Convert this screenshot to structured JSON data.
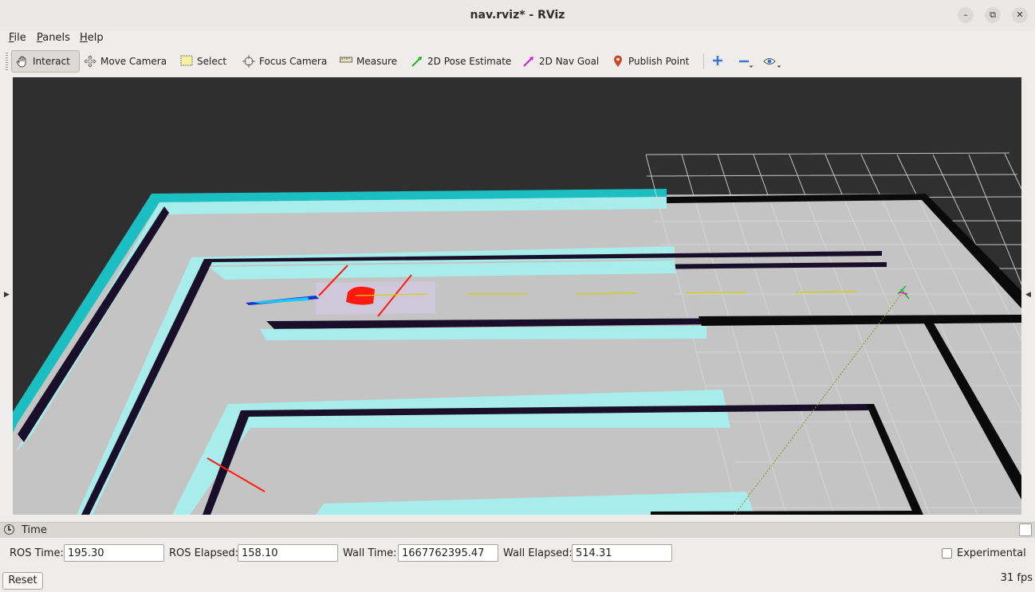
{
  "window": {
    "title": "nav.rviz* - RViz",
    "minimize_glyph": "–",
    "restore_glyph": "⧉",
    "close_glyph": "✕"
  },
  "menu": {
    "items": [
      {
        "label": "File",
        "mnemonic": "F",
        "rest": "ile"
      },
      {
        "label": "Panels",
        "mnemonic": "P",
        "rest": "anels"
      },
      {
        "label": "Help",
        "mnemonic": "H",
        "rest": "elp"
      }
    ]
  },
  "toolbar": {
    "tools": [
      {
        "label": "Interact",
        "icon": "hand-icon",
        "active": true
      },
      {
        "label": "Move Camera",
        "icon": "move-camera-icon"
      },
      {
        "label": "Select",
        "icon": "select-box-icon"
      },
      {
        "label": "Focus Camera",
        "icon": "focus-crosshair-icon"
      },
      {
        "label": "Measure",
        "icon": "ruler-icon"
      },
      {
        "label": "2D Pose Estimate",
        "icon": "green-arrow-icon",
        "color": "#22b422"
      },
      {
        "label": "2D Nav Goal",
        "icon": "magenta-arrow-icon",
        "color": "#d020d0"
      },
      {
        "label": "Publish Point",
        "icon": "map-pin-icon",
        "color": "#c8462a"
      }
    ],
    "add_tool_icon": "plus-icon",
    "remove_tool_icon": "minus-icon",
    "view_icon": "eye-icon"
  },
  "viewport": {
    "background": "#2f2f2f",
    "floor_color": "#c4c4c4",
    "inflation_color": "#a9ecec",
    "wall_color": "#0a0a0a",
    "cyan_edge_color": "#1bbfc2",
    "path_color": "#e8e000",
    "laser_color": "#ff1a10"
  },
  "time_panel": {
    "title": "Time",
    "ros_time_label": "ROS Time:",
    "ros_time": "195.30",
    "ros_elapsed_label": "ROS Elapsed:",
    "ros_elapsed": "158.10",
    "wall_time_label": "Wall Time:",
    "wall_time": "1667762395.47",
    "wall_elapsed_label": "Wall Elapsed:",
    "wall_elapsed": "514.31",
    "experimental_label": "Experimental",
    "experimental_checked": false
  },
  "footer": {
    "reset_label": "Reset",
    "fps": "31 fps"
  }
}
